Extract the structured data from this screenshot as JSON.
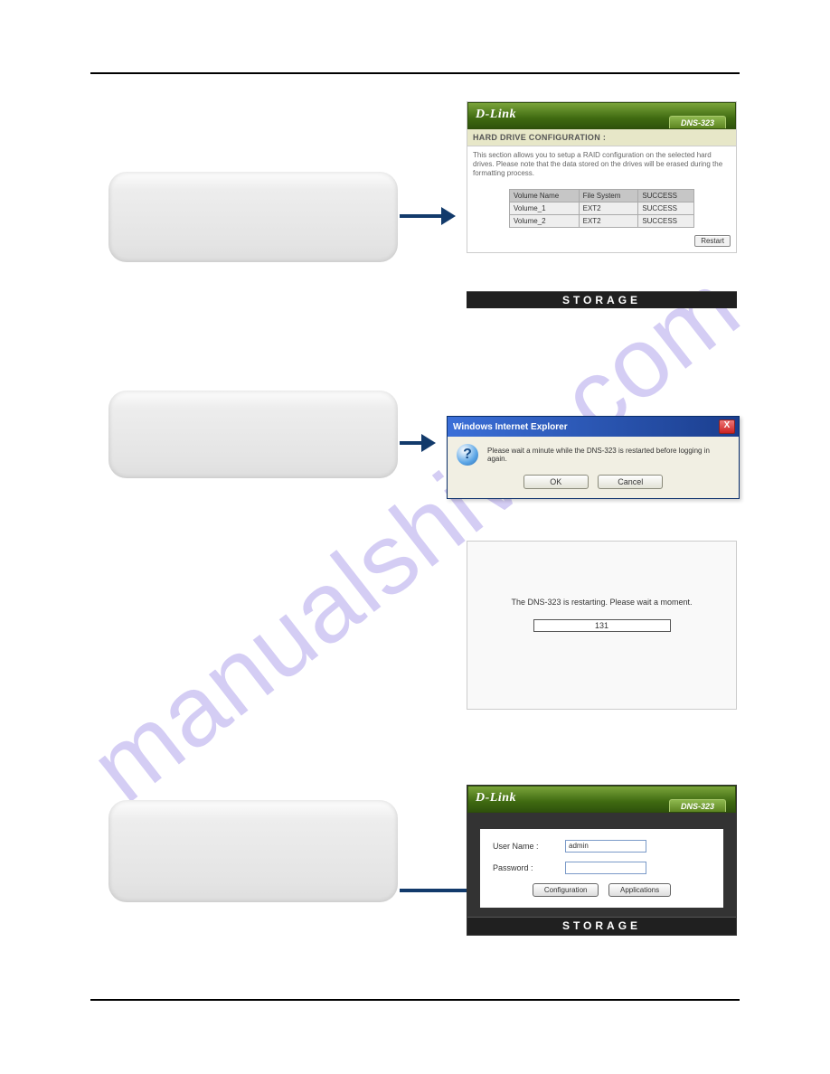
{
  "watermark": "manualshive.com",
  "brand": "D-Link",
  "model": "DNS-323",
  "storage_label": "STORAGE",
  "step1": {
    "title": "HARD DRIVE CONFIGURATION :",
    "desc": "This section allows you to setup a RAID configuration on the selected hard drives. Please note that the data stored on the drives will be erased during the formatting process.",
    "cols": {
      "c1": "Volume Name",
      "c2": "File System",
      "c3": "SUCCESS"
    },
    "rows": [
      {
        "c1": "Volume_1",
        "c2": "EXT2",
        "c3": "SUCCESS"
      },
      {
        "c1": "Volume_2",
        "c2": "EXT2",
        "c3": "SUCCESS"
      }
    ],
    "restart_btn": "Restart"
  },
  "step2": {
    "window_title": "Windows Internet Explorer",
    "message": "Please wait a minute while the DNS-323 is restarted before logging in again.",
    "ok": "OK",
    "cancel": "Cancel",
    "close_glyph": "X"
  },
  "step3": {
    "message": "The DNS-323 is restarting. Please wait a moment.",
    "progress_value": "131"
  },
  "step4": {
    "username_label": "User Name :",
    "password_label": "Password :",
    "username_value": "admin",
    "config_btn": "Configuration",
    "apps_btn": "Applications"
  }
}
